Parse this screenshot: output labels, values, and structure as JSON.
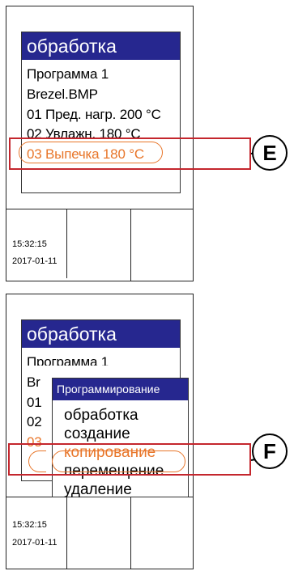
{
  "top_panel": {
    "screen": {
      "title": "обработка",
      "lines": [
        "Программа 1",
        "Brezel.BMP",
        "01 Пред. нагр. 200 °C",
        "02 Увлажн. 180 °C",
        "03 Выпечка 180 °C"
      ],
      "highlighted_index": 4
    },
    "callout": "E",
    "time": "15:32:15",
    "date": "2017-01-11"
  },
  "bottom_panel": {
    "screen": {
      "title": "обработка",
      "lines": [
        "Программа 1",
        "Br",
        "01",
        "02",
        "03"
      ]
    },
    "popup": {
      "title": "Программирование",
      "items": [
        "обработка",
        "создание",
        "копирование",
        "перемещение",
        "удаление"
      ],
      "highlighted_index": 2
    },
    "callout": "F",
    "time": "15:32:15",
    "date": "2017-01-11"
  },
  "colors": {
    "title_bar": "#26278f",
    "highlight": "#e8762a",
    "frame": "#c4262d"
  }
}
